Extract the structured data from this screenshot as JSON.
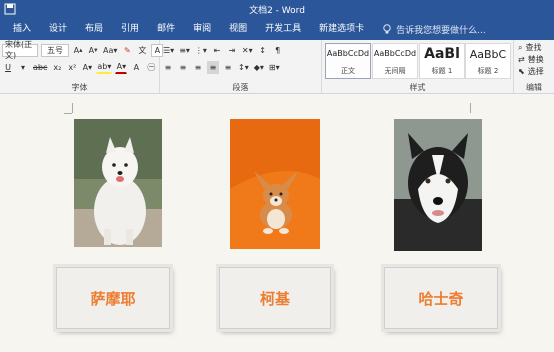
{
  "window": {
    "title": "文档2 - Word"
  },
  "tabs": [
    "插入",
    "设计",
    "布局",
    "引用",
    "邮件",
    "审阅",
    "视图",
    "开发工具",
    "新建选项卡"
  ],
  "tell_me": {
    "placeholder": "告诉我您想要做什么..."
  },
  "ribbon": {
    "font": {
      "name": "宋体(正文)",
      "size": "五号",
      "group_label": "字体"
    },
    "paragraph": {
      "group_label": "段落"
    },
    "styles": {
      "group_label": "样式",
      "items": [
        {
          "sample": "AaBbCcDd",
          "name": "正文"
        },
        {
          "sample": "AaBbCcDd",
          "name": "无间隔"
        },
        {
          "sample": "AaBl",
          "name": "标题 1"
        },
        {
          "sample": "AaBbC",
          "name": "标题 2"
        }
      ]
    },
    "editing": {
      "group_label": "编辑",
      "find": "查找",
      "replace": "替换",
      "select": "选择"
    }
  },
  "document": {
    "cards": [
      {
        "label": "萨摩耶",
        "photo": "samoyed"
      },
      {
        "label": "柯基",
        "photo": "corgi"
      },
      {
        "label": "哈士奇",
        "photo": "husky"
      }
    ]
  },
  "colors": {
    "accent": "#2b579a",
    "label_text": "#ed7d31"
  }
}
